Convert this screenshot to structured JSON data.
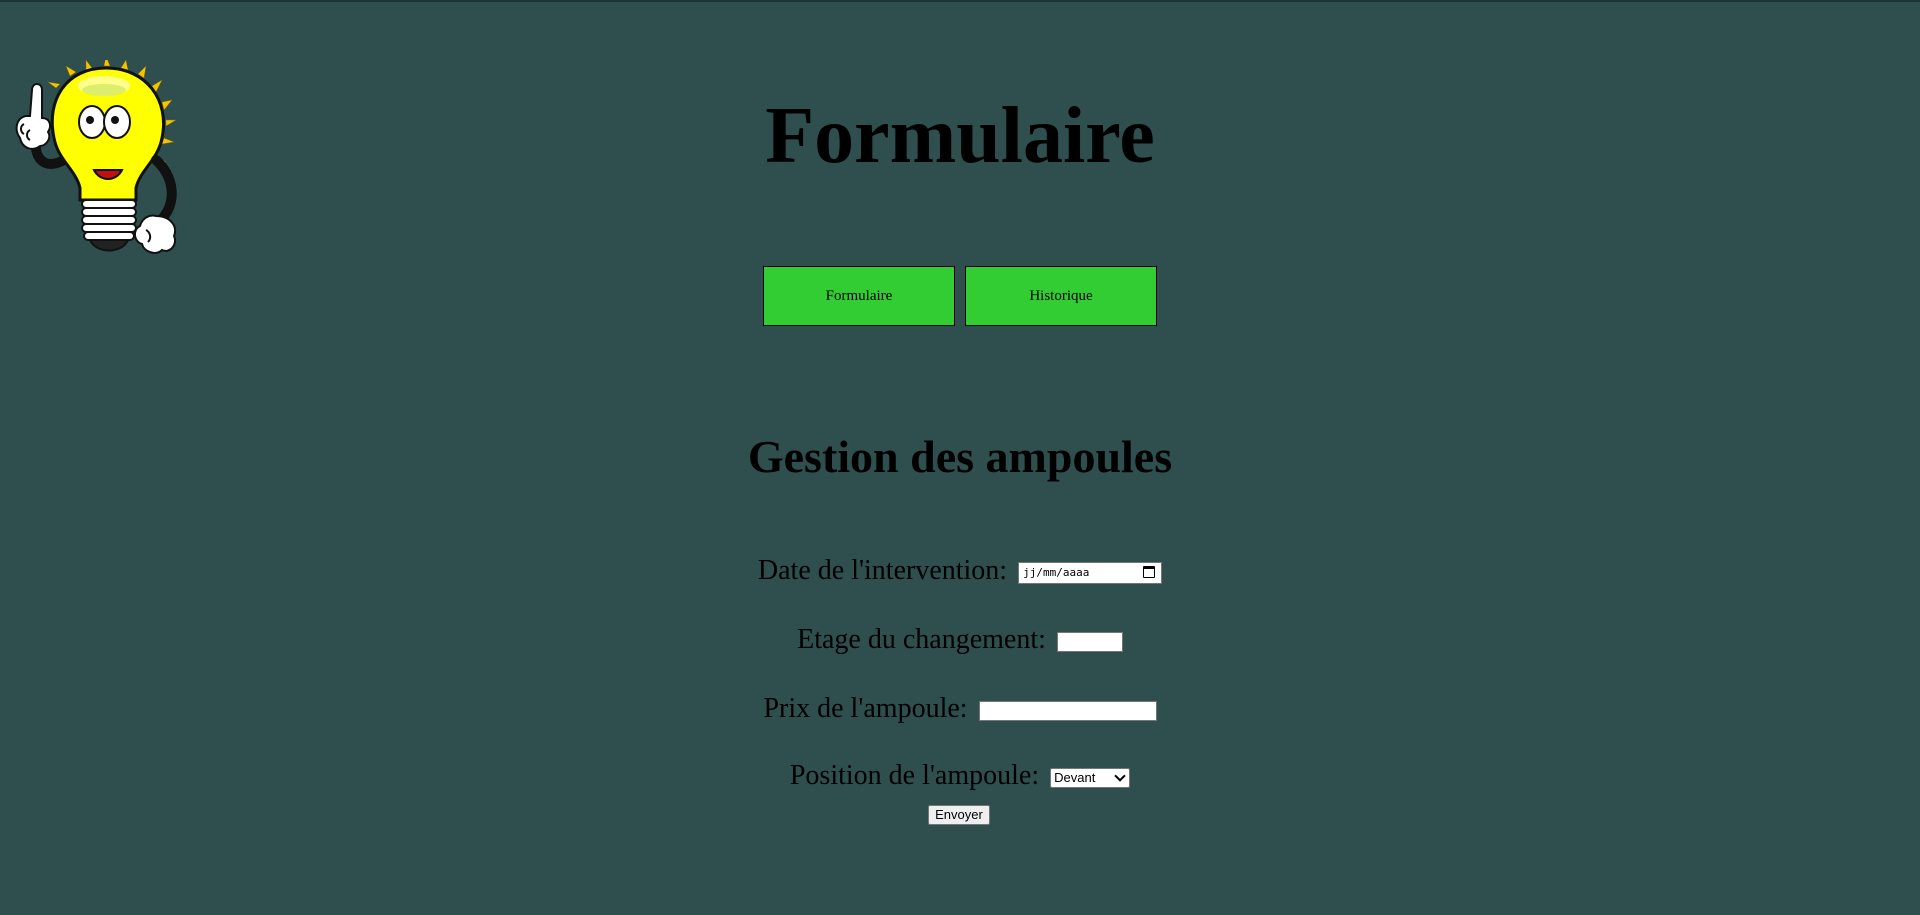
{
  "header": {
    "title": "Formulaire"
  },
  "nav": {
    "form_label": "Formulaire",
    "history_label": "Historique"
  },
  "form": {
    "heading": "Gestion des ampoules",
    "date_label": "Date de l'intervention:",
    "date_placeholder": "jj/mm/aaaa",
    "floor_label": "Etage du changement:",
    "floor_value": "",
    "price_label": "Prix de l'ampoule:",
    "price_value": "",
    "position_label": "Position de l'ampoule:",
    "position_selected": "Devant",
    "submit_label": "Envoyer"
  },
  "colors": {
    "background": "#2f4f4f",
    "button": "#32cd32",
    "bulb": "#ffff00"
  },
  "icons": {
    "mascot": "lightbulb-mascot-icon",
    "calendar": "calendar-icon",
    "select_arrow": "chevron-down-icon"
  }
}
